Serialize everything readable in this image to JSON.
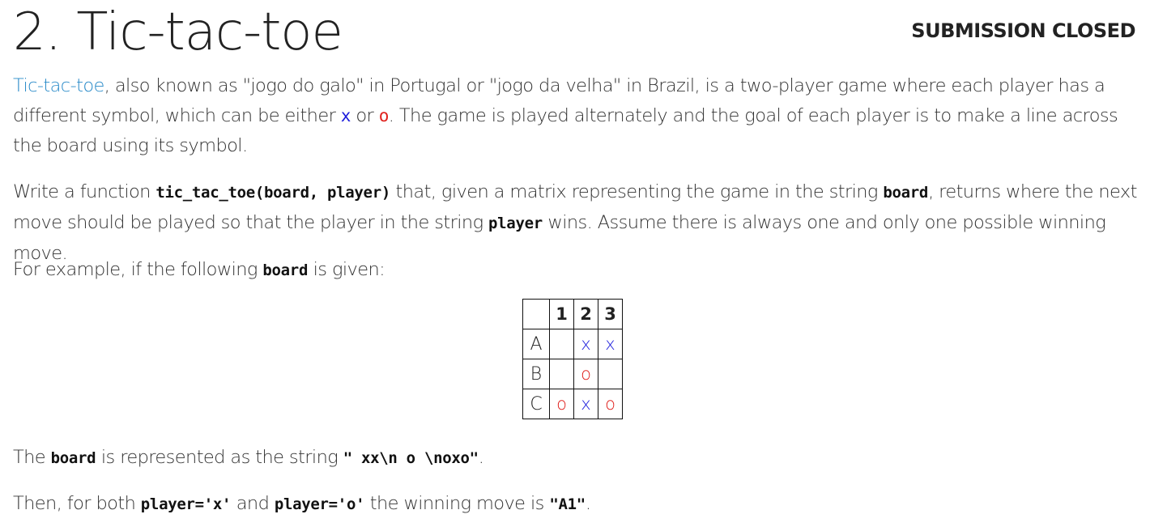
{
  "header": {
    "title": "2. Tic-tac-toe",
    "status": "SUBMISSION CLOSED"
  },
  "intro": {
    "link_text": "Tic-tac-toe",
    "text_1": ", also known as \"jogo do galo\" in Portugal or \"jogo da velha\" in Brazil, is a two-player game where each player has a different symbol, which can be either ",
    "symbol_x": "x",
    "text_2": " or ",
    "symbol_o": "o",
    "text_3": ". The game is played alternately and the goal of each player is to make a line across the board using its symbol."
  },
  "task": {
    "text_1": "Write a function ",
    "signature": "tic_tac_toe(board, player)",
    "text_2": " that, given a matrix representing the game in the string ",
    "board_code": "board",
    "text_3": ", returns where the next move should be played so that the player in the string ",
    "player_code": "player",
    "text_4": " wins. Assume there is always one and only one possible winning move."
  },
  "example": {
    "text_1": "For example, if the following ",
    "board_code": "board",
    "text_2": " is given:"
  },
  "board_table": {
    "corner": "",
    "col_headers": [
      "1",
      "2",
      "3"
    ],
    "rows": [
      {
        "label": "A",
        "cells": [
          "",
          "x",
          "x"
        ]
      },
      {
        "label": "B",
        "cells": [
          "",
          "o",
          ""
        ]
      },
      {
        "label": "C",
        "cells": [
          "o",
          "x",
          "o"
        ]
      }
    ]
  },
  "representation": {
    "text_1": "The ",
    "board_code": "board",
    "text_2": " is represented as the string ",
    "string_code": "\" xx\\n o \\noxo\"",
    "text_3": "."
  },
  "answer": {
    "text_1": "Then, for both ",
    "player_x_code": "player='x'",
    "text_2": " and ",
    "player_o_code": "player='o'",
    "text_3": " the winning move is ",
    "move_code": "\"A1\"",
    "text_4": "."
  },
  "colors": {
    "link": "#2a8bc9",
    "symbol_x": "#1a1adc",
    "symbol_o": "#e0211d"
  }
}
